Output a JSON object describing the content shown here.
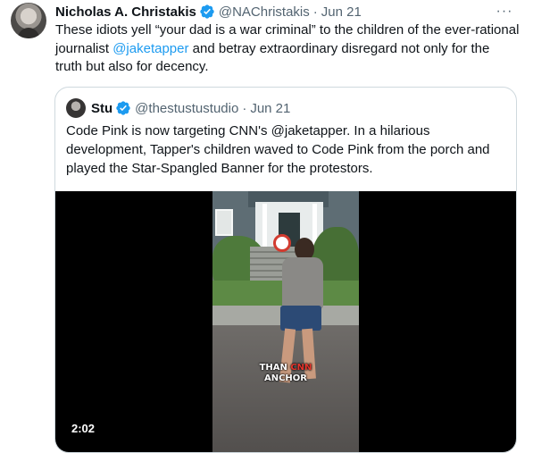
{
  "tweet": {
    "author_name": "Nicholas A. Christakis",
    "author_handle": "@NAChristakis",
    "separator": "·",
    "date": "Jun 21",
    "more_label": "···",
    "text_part1": "These idiots yell “your dad is a war criminal” to the children of the ever-rational journalist ",
    "mention": "@jaketapper",
    "text_part2": " and betray extraordinary disregard not only for the truth but also for decency."
  },
  "quote": {
    "author_name": "Stu",
    "author_handle": "@thestustustudio",
    "separator": "·",
    "date": "Jun 21",
    "text": "Code Pink is now targeting CNN's @jaketapper. In a hilarious development, Tapper's children waved to Code Pink from the porch and played the Star-Spangled Banner for the protestors.",
    "video": {
      "caption_line1_pre": "THAN ",
      "caption_line1_red": "CNN",
      "caption_line2": "ANCHOR",
      "duration": "2:02"
    }
  },
  "colors": {
    "link": "#1d9bf0",
    "verified_badge": "#1d9bf0",
    "secondary_text": "#536471",
    "border": "#cfd9de"
  },
  "icons": {
    "verified": "verified-badge-icon",
    "more": "more-options-icon"
  }
}
